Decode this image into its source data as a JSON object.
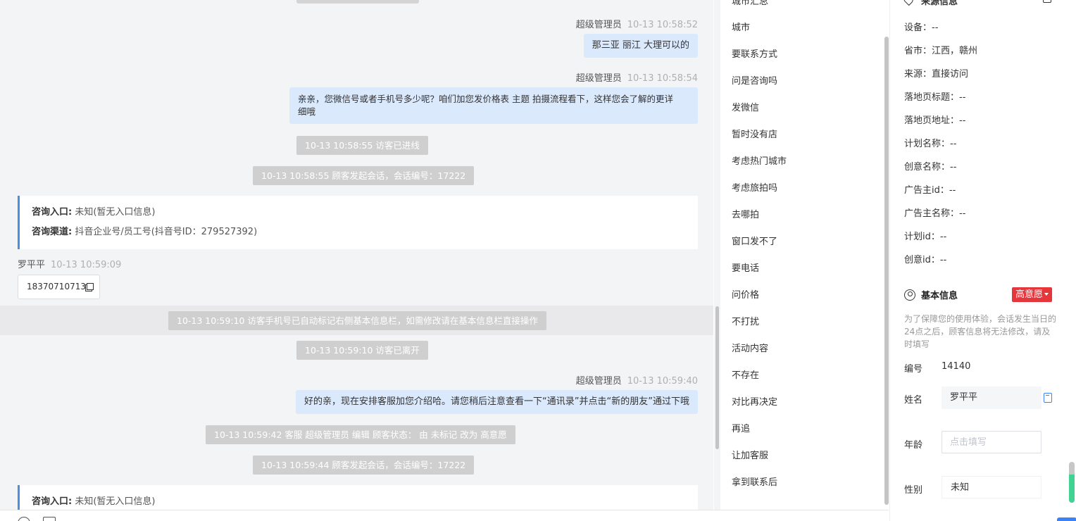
{
  "chat": {
    "messages": [
      {
        "sender": "超级管理员",
        "time": "10-13 10:58:52",
        "text": "那三亚 丽江 大理可以的"
      },
      {
        "sender": "超级管理员",
        "time": "10-13 10:58:54",
        "text_line1": "亲亲，您微信号或者手机号多少呢？咱们加您发价格表 主题 拍摄流程看下，这样您会了解的更详",
        "text_line2": "细哦"
      },
      {
        "sender": "超级管理员",
        "time": "10-13 10:59:40",
        "text": "好的亲，现在安排客服加您介绍哈。请您稍后注意查看一下“通讯录”并点击“新的朋友”通过下哦"
      }
    ],
    "system": [
      "10-13 10:58:55 访客已进线",
      "10-13 10:58:55 顾客发起会话，会话编号：17222",
      "10-13 10:59:10 访客手机号已自动标记右侧基本信息栏，如需修改请在基本信息栏直接操作",
      "10-13 10:59:10 访客已离开",
      "10-13 10:59:42 客服 超级管理员 编辑 顾客状态： 由 未标记 改为 高意愿",
      "10-13 10:59:44 顾客发起会话，会话编号：17222"
    ],
    "info_card": {
      "entry_label": "咨询入口:",
      "entry_value": "未知(暂无入口信息)",
      "channel_label": "咨询渠道:",
      "channel_value": "抖音企业号/员工号(抖音号ID：279527392)"
    },
    "visitor": {
      "name": "罗平平",
      "time": "10-13 10:59:09",
      "phone": "18370710713"
    }
  },
  "phrases": {
    "partial_top": "城市汇总",
    "items": [
      "城市",
      "要联系方式",
      "问是咨询吗",
      "发微信",
      "暂时没有店",
      "考虑热门城市",
      "考虑旅拍吗",
      "去哪拍",
      "窗口发不了",
      "要电话",
      "问价格",
      "不打扰",
      "活动内容",
      "不存在",
      "对比再决定",
      "再追",
      "让加客服",
      "拿到联系后"
    ]
  },
  "source_info": {
    "title": "来源信息",
    "rows": [
      {
        "label": "设备：",
        "value": "--"
      },
      {
        "label": "省市：",
        "value": "江西，赣州"
      },
      {
        "label": "来源：",
        "value": "直接访问"
      },
      {
        "label": "落地页标题：",
        "value": "--"
      },
      {
        "label": "落地页地址：",
        "value": "--"
      },
      {
        "label": "计划名称：",
        "value": "--"
      },
      {
        "label": "创意名称：",
        "value": "--"
      },
      {
        "label": "广告主id：",
        "value": "--"
      },
      {
        "label": "广告主名称：",
        "value": "--"
      },
      {
        "label": "计划id：",
        "value": "--"
      },
      {
        "label": "创意id：",
        "value": "--"
      }
    ]
  },
  "basic_info": {
    "title": "基本信息",
    "intent_badge": "高意愿",
    "notice": "为了保障您的使用体验，会话发生当日的24点之后，顾客信息将无法修改，请及时填写",
    "id_label": "编号",
    "id_value": "14140",
    "name_label": "姓名",
    "name_value": "罗平平",
    "age_label": "年龄",
    "age_placeholder": "点击填写",
    "gender_label": "性别",
    "gender_value": "未知"
  }
}
